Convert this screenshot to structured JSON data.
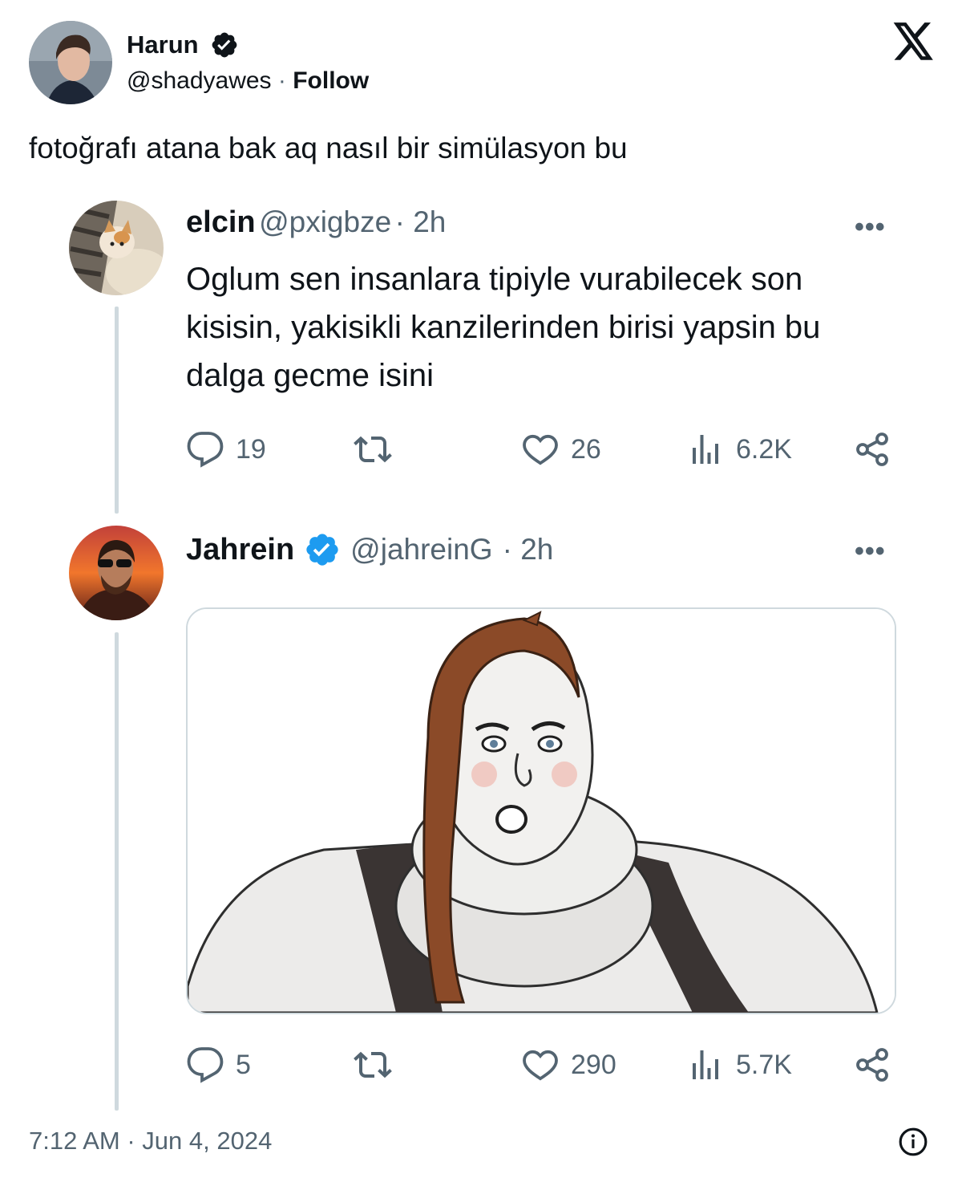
{
  "author": {
    "name": "Harun",
    "handle": "@shadyawes",
    "separator": "·",
    "follow_label": "Follow",
    "icon": "verified-badge-icon"
  },
  "platform_logo": "x-logo-icon",
  "tweet": {
    "text": "fotoğrafı atana bak aq nasıl bir simülasyon bu",
    "timestamp": "7:12 AM · Jun 4, 2024"
  },
  "thread": [
    {
      "name": "elcin",
      "handle": "@pxigbze",
      "time": "· 2h",
      "more": "•••",
      "body": "Oglum sen insanlara tipiyle vurabilecek son kisisin, yakisikli kanzilerinden birisi yapsin bu dalga gecme isini",
      "replies": "19",
      "likes": "26",
      "views": "6.2K"
    },
    {
      "name": "Jahrein",
      "handle": "@jahreinG",
      "time": "· 2h",
      "more": "•••",
      "verified_color": "#1d9bf0",
      "replies": "5",
      "likes": "290",
      "views": "5.7K"
    }
  ],
  "colors": {
    "text": "#0f1419",
    "secondary": "#536471",
    "border": "#cfd9de",
    "verified": "#1d9bf0"
  }
}
